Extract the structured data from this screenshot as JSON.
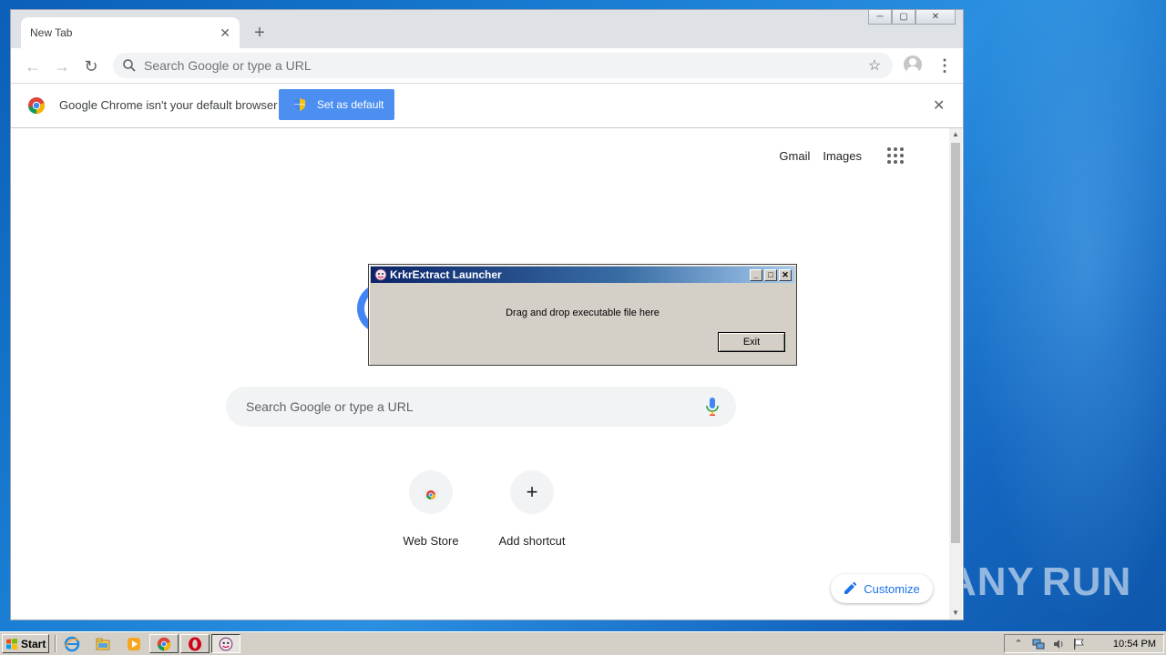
{
  "browser": {
    "tab": {
      "title": "New Tab",
      "close": "✕"
    },
    "new_tab": "+",
    "window_controls": {
      "minimize": "─",
      "maximize": "▢",
      "close": "✕"
    },
    "nav": {
      "back": "←",
      "forward": "→",
      "reload": "↻"
    },
    "omnibox": {
      "placeholder": "Search Google or type a URL",
      "value": ""
    },
    "star": "☆",
    "menu": "⋮",
    "infobar": {
      "message": "Google Chrome isn't your default browser",
      "button": "Set as default",
      "close": "✕"
    }
  },
  "ntp": {
    "top_links": [
      "Gmail",
      "Images"
    ],
    "search": {
      "placeholder": "Search Google or type a URL",
      "value": ""
    },
    "shortcuts": [
      {
        "label": "Web Store",
        "icon": "webstore-icon"
      },
      {
        "label": "Add shortcut",
        "icon": "plus-icon",
        "glyph": "+"
      }
    ],
    "customize": "Customize"
  },
  "dialog": {
    "title": "KrkrExtract Launcher",
    "message": "Drag and drop executable file here",
    "exit": "Exit",
    "controls": {
      "minimize": "_",
      "maximize": "□",
      "close": "✕"
    }
  },
  "taskbar": {
    "start": "Start",
    "clock": "10:54 PM",
    "quick_launch": [
      "ie-icon",
      "explorer-icon",
      "media-player-icon"
    ],
    "tasks": [
      "chrome-icon",
      "opera-icon",
      "krkrextract-icon"
    ]
  },
  "watermark": "ANY RUN",
  "colors": {
    "accent": "#4d8ff0",
    "link": "#1a73e8",
    "dialog_title_start": "#0a246a",
    "dialog_title_end": "#a6caf0"
  }
}
